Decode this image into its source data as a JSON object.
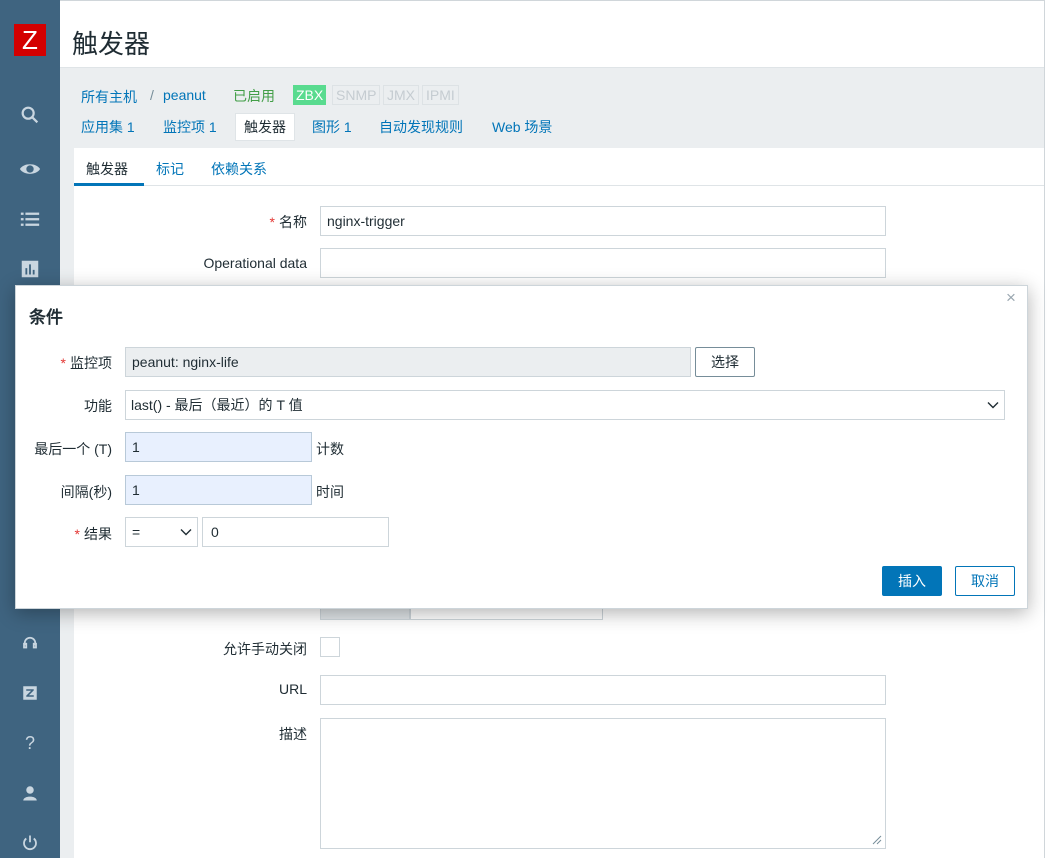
{
  "app": {
    "logo_letter": "Z",
    "page_title": "触发器"
  },
  "breadcrumb": {
    "all_hosts": "所有主机",
    "separator": "/",
    "host": "peanut",
    "status": "已启用",
    "badges": [
      "ZBX",
      "SNMP",
      "JMX",
      "IPMI"
    ]
  },
  "host_tabs": [
    {
      "label": "应用集 1"
    },
    {
      "label": "监控项 1"
    },
    {
      "label": "触发器"
    },
    {
      "label": "图形 1"
    },
    {
      "label": "自动发现规则"
    },
    {
      "label": "Web 场景"
    }
  ],
  "form_tabs": [
    {
      "label": "触发器"
    },
    {
      "label": "标记"
    },
    {
      "label": "依赖关系"
    }
  ],
  "form": {
    "name_label": "名称",
    "name_value": "nginx-trigger",
    "opdata_label": "Operational data",
    "opdata_value": "",
    "manual_close_label": "允许手动关闭",
    "url_label": "URL",
    "url_value": "",
    "description_label": "描述"
  },
  "modal": {
    "title": "条件",
    "close": "×",
    "item_label": "监控项",
    "item_value": "peanut: nginx-life",
    "select_button": "选择",
    "function_label": "功能",
    "function_value": "last() - 最后（最近）的 T 值",
    "last_label": "最后一个 (T)",
    "last_value": "1",
    "last_suffix": "计数",
    "interval_label": "间隔(秒)",
    "interval_value": "1",
    "interval_suffix": "时间",
    "result_label": "结果",
    "operator_value": "=",
    "result_value": "0",
    "insert_button": "插入",
    "cancel_button": "取消"
  },
  "colors": {
    "sidebar": "#3f6480",
    "logo": "#d40000",
    "link": "#0275b8",
    "enabled": "#429e47",
    "zbx_badge": "#59db8f",
    "required": "#e33734"
  },
  "icons": {
    "sidebar": [
      "search-icon",
      "eye-icon",
      "list-icon",
      "chart-icon",
      "headset-icon",
      "zabbix-icon",
      "help-icon",
      "user-icon",
      "power-icon"
    ]
  }
}
